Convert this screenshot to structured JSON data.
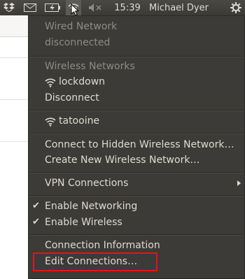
{
  "panel": {
    "clock": "15:39",
    "user": "Michael Dyer",
    "icons": [
      "dropbox-icon",
      "mail-icon",
      "battery-icon",
      "network-icon",
      "volume-muted-icon",
      "power-gear-icon"
    ]
  },
  "menu": {
    "wired_header": "Wired Network",
    "wired_status": "disconnected",
    "wireless_header": "Wireless Networks",
    "network_1": "lockdown",
    "disconnect": "Disconnect",
    "network_2": "tatooine",
    "connect_hidden": "Connect to Hidden Wireless Network…",
    "create_new": "Create New Wireless Network…",
    "vpn": "VPN Connections",
    "enable_networking": "Enable Networking",
    "enable_wireless": "Enable Wireless",
    "connection_info": "Connection Information",
    "edit_connections": "Edit Connections…"
  },
  "colors": {
    "panel_bg": "#3c3b37",
    "menu_bg": "#3c3b37",
    "menu_text": "#dfdbd2",
    "menu_disabled": "#8d8b85",
    "highlight_box": "#e3141b"
  }
}
